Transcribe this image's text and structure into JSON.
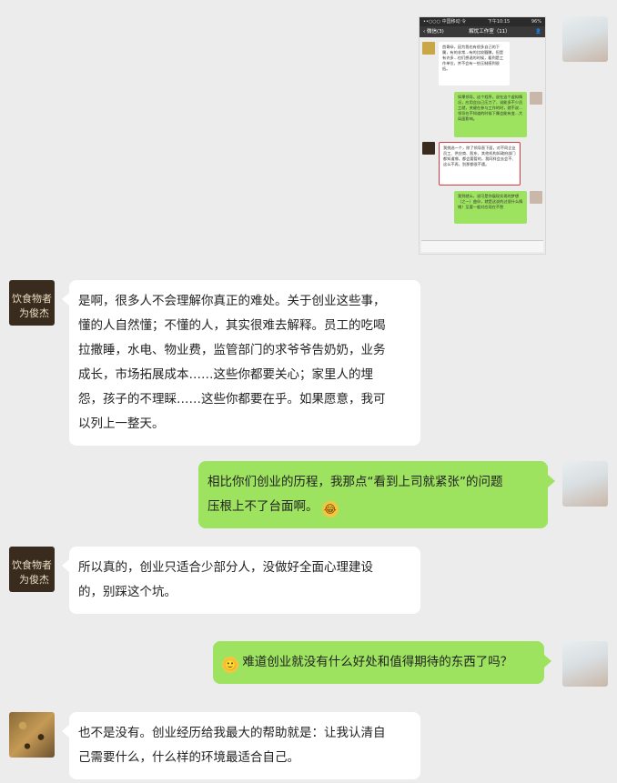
{
  "embedded_screenshot": {
    "status_left": "••○○○ 中国移动 令",
    "status_time": "下午10:15",
    "status_right": "96%",
    "nav_back": "微信(3)",
    "nav_title": "解忧工作室（11）",
    "messages": [
      {
        "side": "left",
        "text": "首哥😀，因为我也有很多自己的下属，有的非常…有的比较腼腆，但是有许多…也们想说的时候，看到是工作单位，并不会有一些压制感到很低。"
      },
      {
        "side": "right",
        "text": "如果领导，这个程序，说在这个虚拟情况，应用会自己压力了，说能多不少员工就，关键在参与工作的时，就不说…领导在不知道的时候下属会能有变…大局面影响。"
      },
      {
        "side": "left",
        "text": "我挑选一个，除了领导直下面，对不同企业员工、供应商、股东、其他机构如政府部门都知道哪，都会要管的，我同样会去会不、这么不再，别那都很不遇。",
        "highlighted": true
      },
      {
        "side": "right",
        "text": "我到就么，说可是你展现实现的梦想（之一）曲😃，就是这说的过很什么情绪！至要一般对应现在不愁"
      }
    ]
  },
  "chat": [
    {
      "id": "msg1",
      "side": "left",
      "avatar": "chalkboard",
      "avatar_text_1": "饮食物者",
      "avatar_text_2": "为俊杰",
      "lines": [
        "是啊，很多人不会理解你真正的难处。关于创业这些事，",
        "懂的人自然懂；不懂的人，其实很难去解释。员工的吃喝",
        "拉撒睡，水电、物业费，监管部门的求爷爷告奶奶，业务",
        "成长，市场拓展成本……这些你都要关心；家里人的埋",
        "怨，孩子的不理睬……这些你都要在乎。如果愿意，我可",
        "以列上一整天。"
      ]
    },
    {
      "id": "msg2",
      "side": "right",
      "avatar": "woman",
      "lines": [
        "相比你们创业的历程，我那点“看到上司就紧张”的问题",
        "压根上不了台面啊。"
      ],
      "emoji": "😂"
    },
    {
      "id": "msg3",
      "side": "left",
      "avatar": "chalkboard",
      "avatar_text_1": "饮食物者",
      "avatar_text_2": "为俊杰",
      "lines": [
        "所以真的，创业只适合少部分人，没做好全面心理建设",
        "的，别踩这个坑。"
      ]
    },
    {
      "id": "msg4",
      "side": "right",
      "avatar": "woman",
      "emoji_prefix": "🙂",
      "lines": [
        "难道创业就没有什么好处和值得期待的东西了吗？"
      ]
    },
    {
      "id": "msg5",
      "side": "left",
      "avatar": "leopard",
      "lines": [
        "也不是没有。创业经历给我最大的帮助就是：让我认清自",
        "己需要什么，什么样的环境最适合自己。"
      ]
    }
  ]
}
